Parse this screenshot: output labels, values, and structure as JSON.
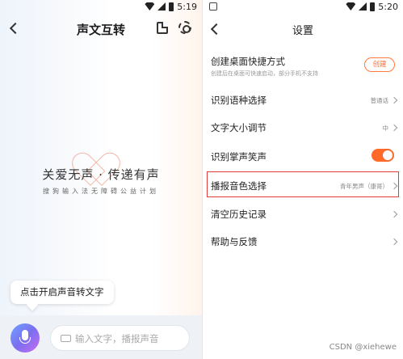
{
  "left": {
    "status_time": "5:19",
    "header_title": "声文互转",
    "slogan": "关爱无声 · 传递有声",
    "slogan_sub": "搜狗输入法无障碍公益计划",
    "tooltip": "点击开启声音转文字",
    "input_placeholder": "输入文字，播报声音"
  },
  "right": {
    "status_time": "5:20",
    "header_title": "设置",
    "items": [
      {
        "label": "创建桌面快捷方式",
        "sub": "创建后在桌面可快速启动，部分手机不支持",
        "button": "创建"
      },
      {
        "label": "识别语种选择",
        "value": "普通话"
      },
      {
        "label": "文字大小调节",
        "value": "中"
      },
      {
        "label": "识别掌声笑声",
        "toggle": true
      },
      {
        "label": "播报音色选择",
        "value": "青年男声（康哥）"
      },
      {
        "label": "清空历史记录"
      },
      {
        "label": "帮助与反馈"
      }
    ]
  },
  "watermark": "CSDN @xiehewe",
  "colors": {
    "accent": "#ff6a2b",
    "highlight": "#e23b3b"
  }
}
